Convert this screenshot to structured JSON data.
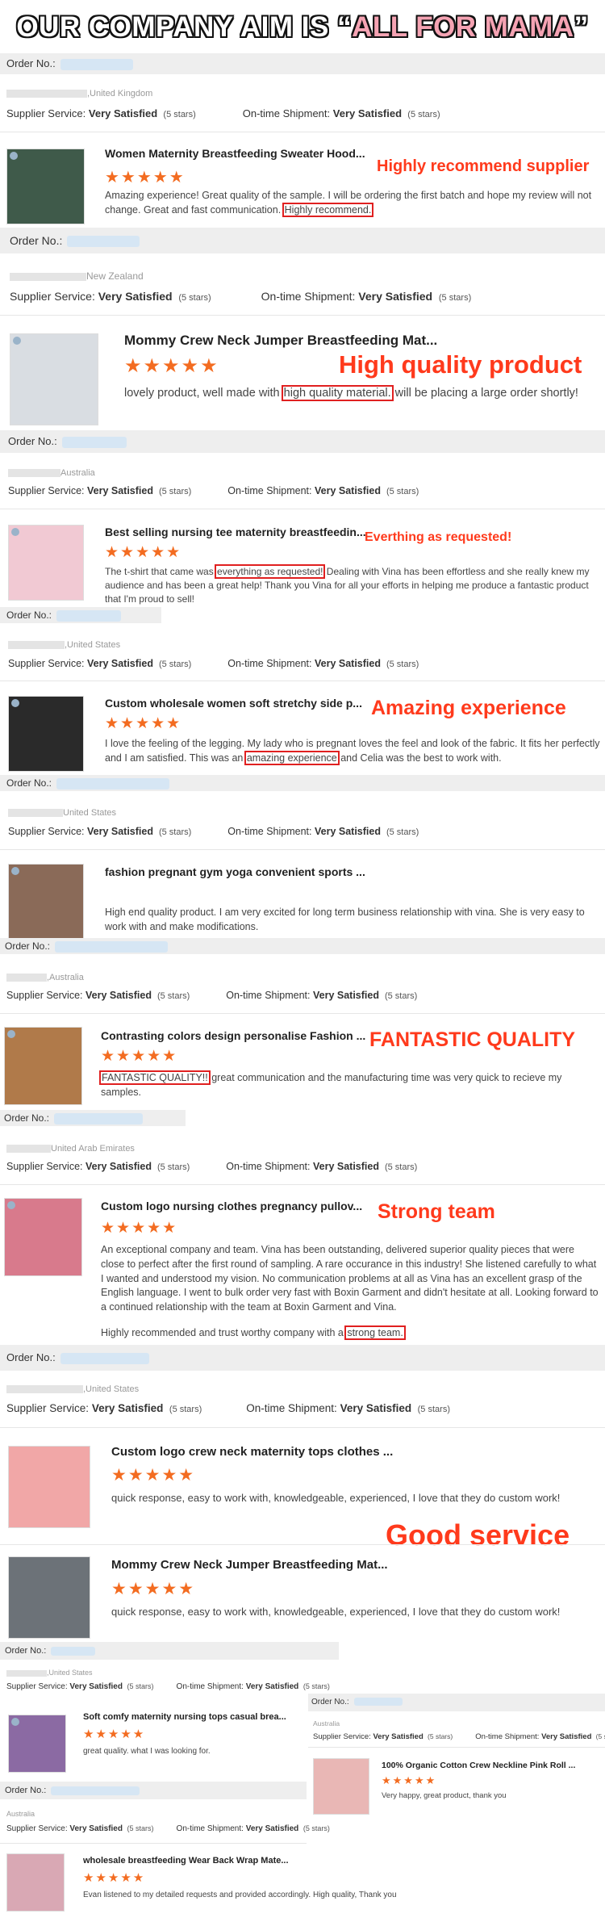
{
  "banner": {
    "prefix": "OUR COMPANY AIM IS ",
    "quote_open": "“",
    "highlight": "ALL FOR MAMA",
    "quote_close": "”"
  },
  "labels": {
    "order_no": "Order No.:",
    "supplier_service": "Supplier Service:",
    "on_time_shipment": "On-time Shipment:",
    "very_satisfied": "Very Satisfied",
    "five_stars": "(5 stars)"
  },
  "stars": "★★★★★",
  "reviews": [
    {
      "country": ",United Kingdom",
      "title": "Women Maternity Breastfeeding Sweater Hood...",
      "callout": "Highly recommend supplier",
      "text_before": "Amazing experience! Great quality of the sample. I will be ordering the first batch and hope my review will not change. Great and fast communication. ",
      "highlight": "Highly recommend.",
      "text_after": ""
    },
    {
      "country": "New Zealand",
      "title": "Mommy Crew Neck Jumper Breastfeeding Mat...",
      "callout": "High quality product",
      "text_before": "lovely product, well made with ",
      "highlight": "high quality material.",
      "text_after": " will be placing a large order shortly!"
    },
    {
      "country": "Australia",
      "title": "Best selling nursing tee maternity breastfeedin...",
      "callout": "Everthing as requested!",
      "text_before": "The t-shirt that came was ",
      "highlight": "everything as requested!",
      "text_after": " Dealing with Vina has been effortless and she really knew my audience and has been a great help! Thank you Vina for all your efforts in helping me produce a fantastic product that I'm proud to sell!"
    },
    {
      "country": ",United States",
      "title": "Custom wholesale women soft stretchy side p...",
      "callout": "Amazing experience",
      "text_before": "I love the feeling of the legging. My lady who is pregnant loves the feel and look of the fabric. It fits her perfectly and I am satisfied. This was an ",
      "highlight": "amazing experience",
      "text_after": " and Celia was the best to work with."
    },
    {
      "country": "United States",
      "title": "fashion pregnant gym yoga convenient sports ...",
      "callout": "",
      "text_before": "High end quality product. I am very excited for long term business relationship with vina. She is very easy to work with and make modifications.",
      "highlight": "",
      "text_after": ""
    },
    {
      "country": ",Australia",
      "title": "Contrasting colors design personalise Fashion ...",
      "callout": "FANTASTIC QUALITY",
      "text_before": "",
      "highlight": "FANTASTIC QUALITY!!",
      "text_after": " great communication and the manufacturing time was very quick to recieve my samples."
    },
    {
      "country": "United Arab Emirates",
      "title": "Custom logo nursing clothes pregnancy pullov...",
      "callout": "Strong team",
      "text_before": "An exceptional company and team. Vina has been outstanding, delivered superior quality pieces that were close to perfect after the first round of sampling. A rare occurance in this industry! She listened carefully to what I wanted and understood my vision. No communication problems at all as Vina has an excellent grasp of the English language.  I went to bulk order very fast with Boxin Garment and didn't hesitate at all. Looking forward to a continued relationship with the team at Boxin Garment and Vina.",
      "text2_before": "Highly recommended and trust worthy company with a ",
      "highlight": "strong team.",
      "text_after": ""
    },
    {
      "country": ",United States",
      "title": "Custom logo crew neck maternity tops clothes ...",
      "callout": "",
      "text_before": "quick response, easy to work with, knowledgeable, experienced, I love that they do custom work!",
      "highlight": "",
      "text_after": ""
    },
    {
      "country": "",
      "title": "Mommy Crew Neck Jumper Breastfeeding Mat...",
      "callout": "Good service",
      "text_before": "quick response, easy to work with, knowledgeable, experienced, I love that they do custom work!",
      "highlight": "",
      "text_after": ""
    },
    {
      "country": ",United States",
      "title": "Soft comfy maternity nursing tops casual brea...",
      "callout": "",
      "text_before": "great quality. what I was looking for.",
      "highlight": "",
      "text_after": ""
    },
    {
      "country": "Australia",
      "title": "100% Organic Cotton Crew Neckline Pink Roll ...",
      "callout": "",
      "text_before": "Very happy, great product, thank you",
      "highlight": "",
      "text_after": ""
    },
    {
      "country": "Australia",
      "title": "wholesale breastfeeding Wear Back Wrap Mate...",
      "callout": "",
      "text_before": "Evan listened to my detailed requests and provided accordingly. High quality, Thank you",
      "highlight": "",
      "text_after": ""
    }
  ],
  "colors": {
    "accent_star": "#f36c21",
    "callout": "#ff3a1c",
    "highlight_box": "#e02020",
    "band": "#eeeeee"
  }
}
